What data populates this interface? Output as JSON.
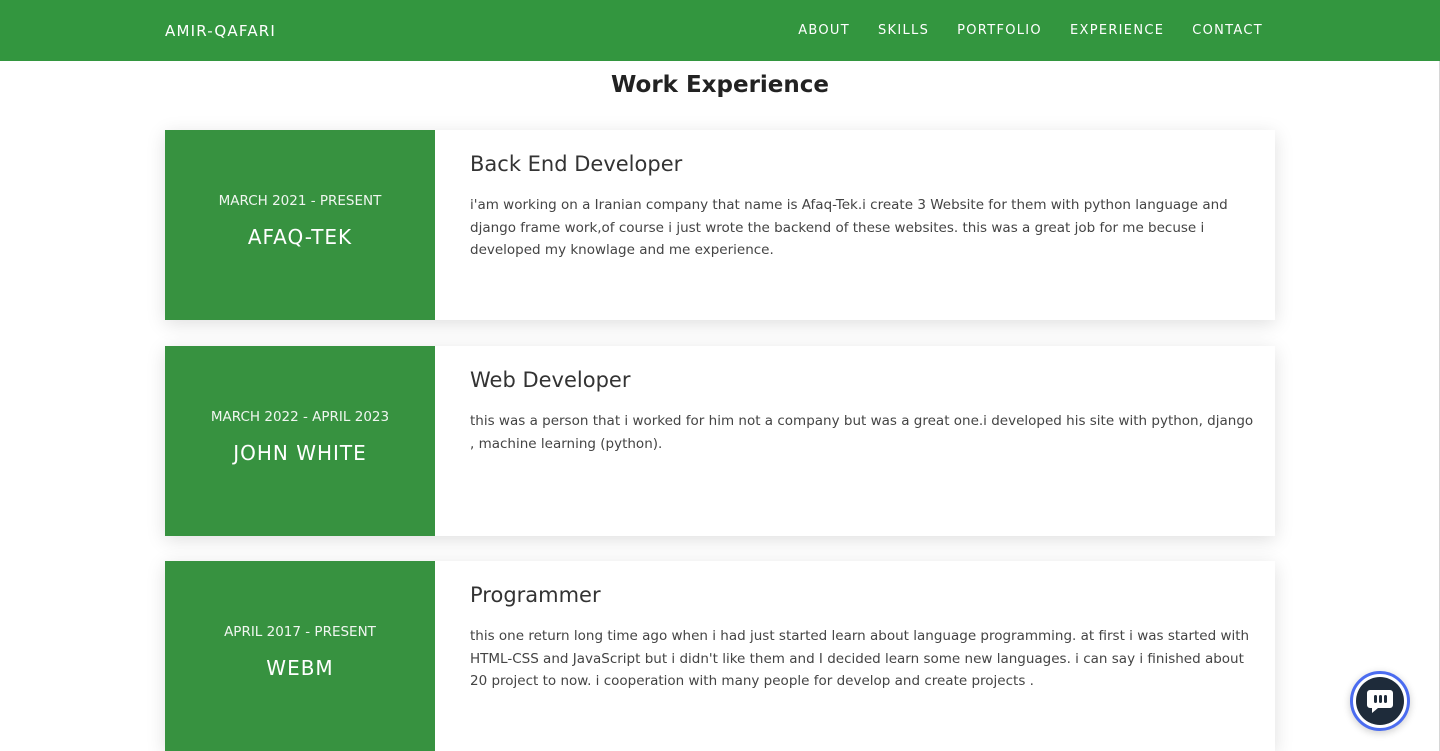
{
  "nav": {
    "brand": "AMIR-QAFARI",
    "links": [
      "ABOUT",
      "SKILLS",
      "PORTFOLIO",
      "EXPERIENCE",
      "CONTACT"
    ]
  },
  "section": {
    "title": "Work Experience"
  },
  "experience": [
    {
      "date": "MARCH 2021 - PRESENT",
      "company": "AFAQ-TEK",
      "role": "Back End Developer",
      "description": "i'am working on a Iranian company that name is Afaq-Tek.i create 3 Website for them with python language and django frame work,of course i just wrote the backend of these websites. this was a great job for me becuse i developed my knowlage and me experience."
    },
    {
      "date": "MARCH 2022 - APRIL 2023",
      "company": "JOHN WHITE",
      "role": "Web Developer",
      "description": "this was a person that i worked for him not a company but was a great one.i developed his site with python, django , machine learning (python)."
    },
    {
      "date": "APRIL 2017 - PRESENT",
      "company": "WEBM",
      "role": "Programmer",
      "description": "this one return long time ago when i had just started learn about language programming. at first i was started with HTML-CSS and JavaScript but i didn't like them and I decided learn some new languages. i can say i finished about 20 project to now. i cooperation with many people for develop and create projects ."
    }
  ],
  "colors": {
    "accent": "#379240",
    "chat_ring": "#4b6cf0",
    "chat_bg": "#1e2b3a"
  },
  "icons": {
    "chat": "chat-bubble-icon"
  }
}
